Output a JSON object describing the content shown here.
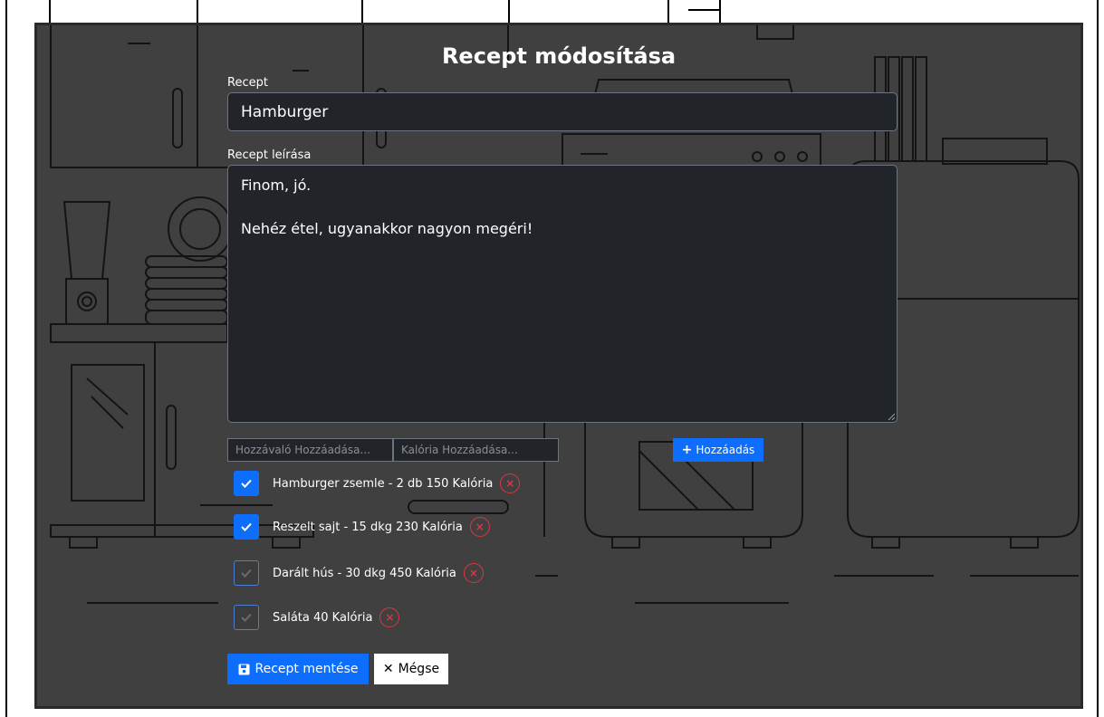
{
  "page": {
    "title": "Recept módosítása"
  },
  "form": {
    "recipe_label": "Recept",
    "recipe_value": "Hamburger",
    "description_label": "Recept leírása",
    "description_value": "Finom, jó.\n\nNehéz étel, ugyanakkor nagyon megéri!",
    "ingredient_placeholder": "Hozzávaló Hozzáadása...",
    "calorie_placeholder": "Kalória Hozzáadása...",
    "add_label": "Hozzáadás"
  },
  "ingredients": [
    {
      "text": "Hamburger zsemle - 2 db 150 Kalória",
      "checked": true
    },
    {
      "text": "Reszelt sajt - 15 dkg 230 Kalória",
      "checked": true
    },
    {
      "text": "Darált hús - 30 dkg 450 Kalória",
      "checked": false
    },
    {
      "text": "Saláta 40 Kalória",
      "checked": false
    }
  ],
  "actions": {
    "save_label": "Recept mentése",
    "cancel_label": "Mégse"
  },
  "colors": {
    "primary": "#0d6efd",
    "danger": "#dc3545",
    "panel": "#404040",
    "field": "#212529"
  }
}
